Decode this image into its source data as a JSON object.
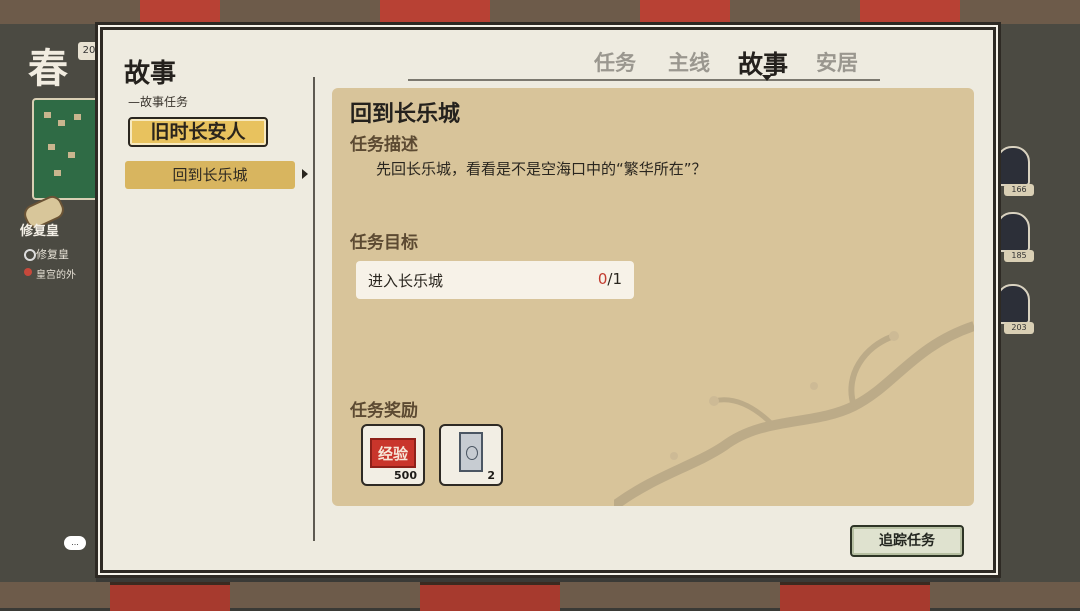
{
  "hud": {
    "season": "春",
    "year_chip": "20",
    "left_quest_title": "修复皇",
    "left_quest_step": "修复皇",
    "left_quest_location": "皇宫的外",
    "chat_bubble": "...",
    "npc_levels": [
      "166",
      "185",
      "203"
    ]
  },
  "left_panel": {
    "title": "故事",
    "subtitle": "—故事任务",
    "story_button": "旧时长安人",
    "quest_items": [
      "回到长乐城"
    ]
  },
  "tabs": [
    {
      "label": "任务",
      "active": false
    },
    {
      "label": "主线",
      "active": false
    },
    {
      "label": "故事",
      "active": true
    },
    {
      "label": "安居",
      "active": false
    }
  ],
  "quest": {
    "title": "回到长乐城",
    "description_header": "任务描述",
    "description": "先回长乐城，看看是不是空海口中的“繁华所在”？",
    "goal_header": "任务目标",
    "goal": {
      "label": "进入长乐城",
      "current": "0",
      "total": "/1"
    },
    "reward_header": "任务奖励",
    "rewards": [
      {
        "icon": "exp-stamp-icon",
        "label": "经验",
        "qty": "500"
      },
      {
        "icon": "silver-note-icon",
        "label": "",
        "qty": "2"
      }
    ]
  },
  "track_button": "追踪任务",
  "colors": {
    "panel_bg": "#d8c49a",
    "story_button_bg": "#e8c25e",
    "list_item_bg": "#d8b55f",
    "exp_red": "#c9352b",
    "progress_red": "#c23a2e"
  }
}
